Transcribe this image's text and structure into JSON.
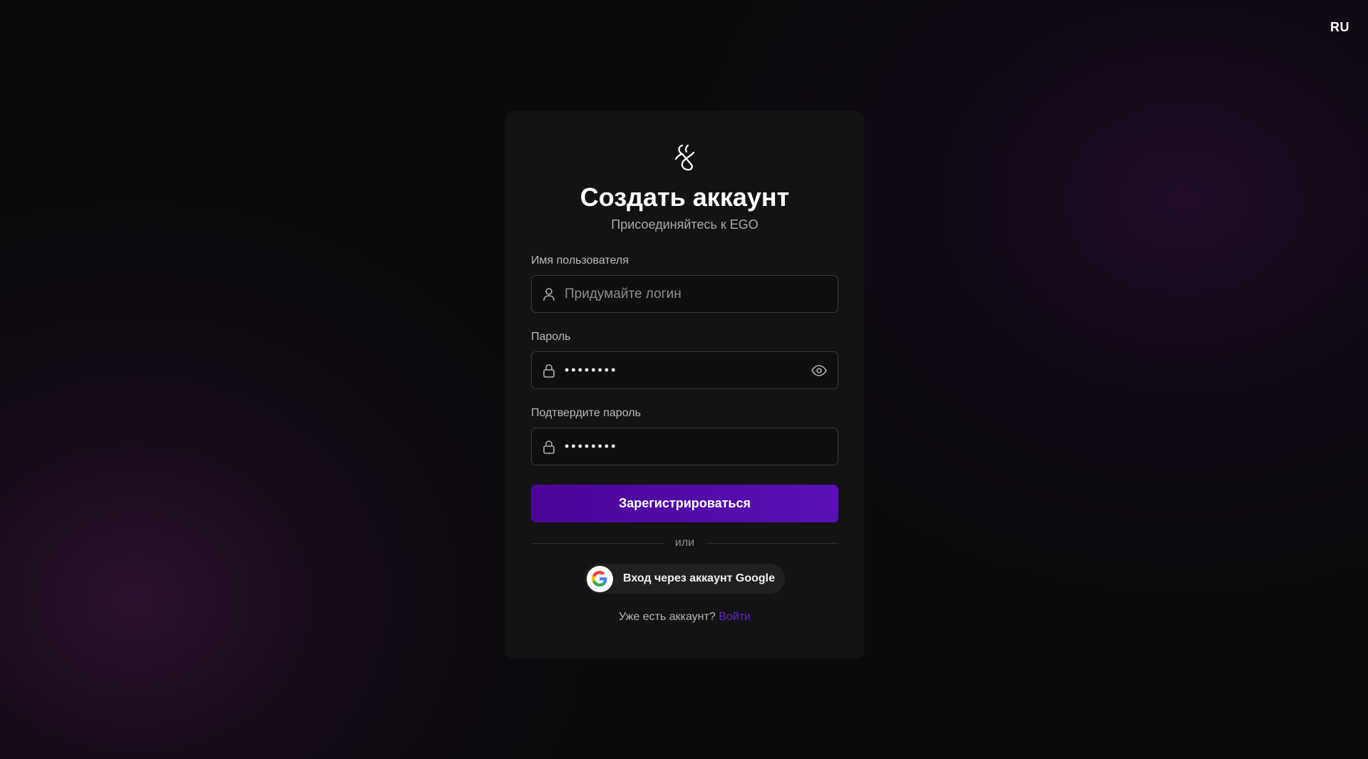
{
  "language_switch": "RU",
  "logo": {
    "icon": "ego-logo-icon"
  },
  "header": {
    "title": "Создать аккаунт",
    "subtitle": "Присоединяйтесь к EGO"
  },
  "form": {
    "username": {
      "label": "Имя пользователя",
      "placeholder": "Придумайте логин",
      "value": "",
      "icon": "user-icon"
    },
    "password": {
      "label": "Пароль",
      "value": "12345678",
      "icon": "lock-icon",
      "toggle_icon": "eye-icon"
    },
    "confirm_password": {
      "label": "Подтвердите пароль",
      "value": "12345678",
      "icon": "lock-icon"
    },
    "submit_label": "Зарегистрироваться"
  },
  "divider_text": "или",
  "google": {
    "label": "Вход через аккаунт Google",
    "icon": "google-icon"
  },
  "footer": {
    "question": "Уже есть аккаунт?",
    "link": "Войти"
  },
  "colors": {
    "background": "#0b0b0d",
    "card": "#131314",
    "accent": "#5910b8",
    "link": "#6a1fcf"
  }
}
